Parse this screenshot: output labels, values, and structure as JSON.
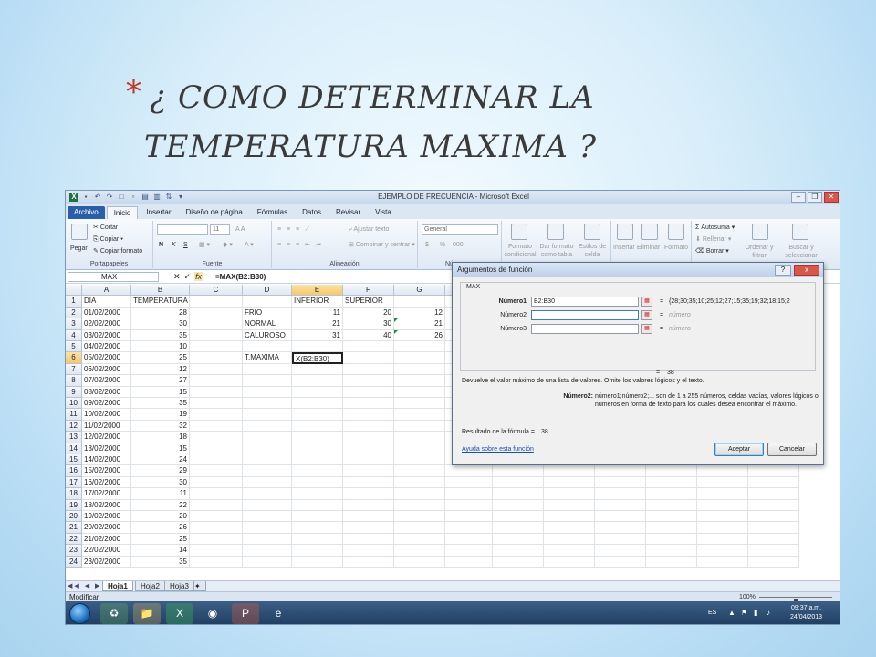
{
  "slide": {
    "bullet": "*",
    "title_line1": "¿ COMO DETERMINAR LA",
    "title_line2": "TEMPERATURA MAXIMA ?"
  },
  "window": {
    "title": "EJEMPLO DE FRECUENCIA - Microsoft Excel"
  },
  "ribbon": {
    "tabs": [
      "Archivo",
      "Inicio",
      "Insertar",
      "Diseño de página",
      "Fórmulas",
      "Datos",
      "Revisar",
      "Vista"
    ],
    "active_tab": "Inicio",
    "clipboard": {
      "paste": "Pegar",
      "cut": "Cortar",
      "copy": "Copiar",
      "format_painter": "Copiar formato",
      "label": "Portapapeles"
    },
    "font": {
      "size": "11",
      "bold": "N",
      "italic": "K",
      "underline": "S",
      "label": "Fuente"
    },
    "alignment": {
      "wrap": "Ajustar texto",
      "merge": "Combinar y centrar",
      "label": "Alineación"
    },
    "number": {
      "format": "General",
      "currency": "$",
      "percent": "%",
      "thousands": "000",
      "label": "Núm"
    },
    "styles": {
      "conditional": "Formato condicional",
      "table": "Dar formato como tabla",
      "cell_styles": "Estilos de celda"
    },
    "cells": {
      "insert": "Insertar",
      "delete": "Eliminar",
      "format": "Formato"
    },
    "editing": {
      "autosum": "Autosuma",
      "fill": "Rellenar",
      "clear": "Borrar",
      "sort": "Ordenar y filtrar",
      "find": "Buscar y seleccionar"
    }
  },
  "formula_bar": {
    "name_box": "MAX",
    "fx": "fx",
    "formula": "=MAX(B2:B30)"
  },
  "grid": {
    "columns": [
      "A",
      "B",
      "C",
      "D",
      "E",
      "F",
      "G"
    ],
    "rows": [
      [
        "DIA",
        "TEMPERATURA",
        "",
        "",
        "INFERIOR",
        "SUPERIOR",
        ""
      ],
      [
        "01/02/2000",
        "28",
        "",
        "FRIO",
        "11",
        "20",
        "12"
      ],
      [
        "02/02/2000",
        "30",
        "",
        "NORMAL",
        "21",
        "30",
        "21"
      ],
      [
        "03/02/2000",
        "35",
        "",
        "CALUROSO",
        "31",
        "40",
        "26"
      ],
      [
        "04/02/2000",
        "10",
        "",
        "",
        "",
        "",
        ""
      ],
      [
        "05/02/2000",
        "25",
        "",
        "T.MAXIMA",
        "X(B2:B30)",
        "",
        ""
      ],
      [
        "06/02/2000",
        "12",
        "",
        "",
        "",
        "",
        ""
      ],
      [
        "07/02/2000",
        "27",
        "",
        "",
        "",
        "",
        ""
      ],
      [
        "08/02/2000",
        "15",
        "",
        "",
        "",
        "",
        ""
      ],
      [
        "09/02/2000",
        "35",
        "",
        "",
        "",
        "",
        ""
      ],
      [
        "10/02/2000",
        "19",
        "",
        "",
        "",
        "",
        ""
      ],
      [
        "11/02/2000",
        "32",
        "",
        "",
        "",
        "",
        ""
      ],
      [
        "12/02/2000",
        "18",
        "",
        "",
        "",
        "",
        ""
      ],
      [
        "13/02/2000",
        "15",
        "",
        "",
        "",
        "",
        ""
      ],
      [
        "14/02/2000",
        "24",
        "",
        "",
        "",
        "",
        ""
      ],
      [
        "15/02/2000",
        "29",
        "",
        "",
        "",
        "",
        ""
      ],
      [
        "16/02/2000",
        "30",
        "",
        "",
        "",
        "",
        ""
      ],
      [
        "17/02/2000",
        "11",
        "",
        "",
        "",
        "",
        ""
      ],
      [
        "18/02/2000",
        "22",
        "",
        "",
        "",
        "",
        ""
      ],
      [
        "19/02/2000",
        "20",
        "",
        "",
        "",
        "",
        ""
      ],
      [
        "20/02/2000",
        "26",
        "",
        "",
        "",
        "",
        ""
      ],
      [
        "21/02/2000",
        "25",
        "",
        "",
        "",
        "",
        ""
      ],
      [
        "22/02/2000",
        "14",
        "",
        "",
        "",
        "",
        ""
      ],
      [
        "23/02/2000",
        "35",
        "",
        "",
        "",
        "",
        ""
      ]
    ]
  },
  "sheets": [
    "Hoja1",
    "Hoja2",
    "Hoja3"
  ],
  "active_sheet": "Hoja1",
  "status": {
    "mode": "Modificar",
    "zoom": "100%",
    "zoom_level_percent": 100
  },
  "taskbar": {
    "lang": "ES",
    "time": "09:37 a.m.",
    "date": "24/04/2013"
  },
  "dialog": {
    "title": "Argumentos de función",
    "function": "MAX",
    "args": [
      {
        "label": "Número1",
        "value": "B2:B30",
        "result": "{28;30;35;10;25;12;27;15;35;19;32;18;15;2"
      },
      {
        "label": "Número2",
        "value": "",
        "result": "número"
      },
      {
        "label": "Número3",
        "value": "",
        "result": "número"
      }
    ],
    "eq": "=",
    "total": "38",
    "description": "Devuelve el valor máximo de una lista de valores. Omite los valores lógicos y el texto.",
    "arg_help_label": "Número2:",
    "arg_help_line1": "número1;número2;... son de 1 a 255 números, celdas vacías, valores lógicos o",
    "arg_help_line2": "números en forma de texto para los cuales desea encontrar el máximo.",
    "result_label": "Resultado de la fórmula =",
    "result_value": "38",
    "help_link": "Ayuda sobre esta función",
    "ok": "Aceptar",
    "cancel": "Cancelar",
    "help_btn": "?",
    "close_btn": "x"
  }
}
